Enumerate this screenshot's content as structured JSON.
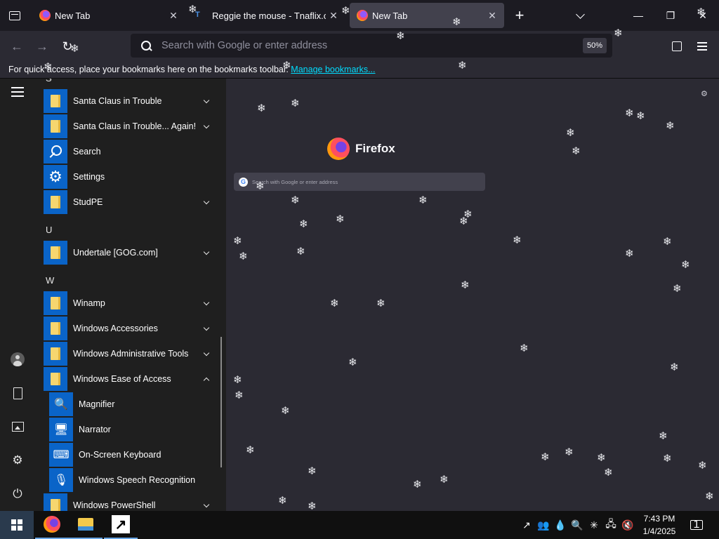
{
  "browser": {
    "tabs": [
      {
        "title": "New Tab",
        "close": "✕"
      },
      {
        "title": "Reggie the mouse - Tnaflix.com",
        "close": "✕"
      },
      {
        "title": "New Tab",
        "close": "✕"
      }
    ],
    "new_tab": "+",
    "window_controls": {
      "minimize": "—",
      "restore": "❐",
      "close": "✕"
    },
    "nav": {
      "back": "←",
      "forward": "→",
      "reload": "↻"
    },
    "urlbar_placeholder": "Search with Google or enter address",
    "zoom": "50%",
    "bookmarks_text": "For quick access, place your bookmarks here on the bookmarks toolbar.",
    "bookmarks_link": "Manage bookmarks..."
  },
  "newtab": {
    "brand": "Firefox",
    "search_placeholder": "Search with Google or enter address",
    "google_glyph": "G",
    "settings_glyph": "⚙"
  },
  "start_menu": {
    "rail_icons": [
      "hamburger-icon",
      "user-icon",
      "documents-icon",
      "pictures-icon",
      "settings-icon",
      "power-icon"
    ],
    "rail_glyphs": {
      "settings": "⚙",
      "power": "⏻"
    },
    "letters": {
      "s": "S",
      "u": "U",
      "w": "W"
    },
    "apps": [
      {
        "label": "Santa Claus in Trouble"
      },
      {
        "label": "Santa Claus in Trouble... Again!"
      },
      {
        "label": "Search"
      },
      {
        "label": "Settings"
      },
      {
        "label": "StudPE"
      },
      {
        "label": "Undertale [GOG.com]"
      },
      {
        "label": "Winamp"
      },
      {
        "label": "Windows Accessories"
      },
      {
        "label": "Windows Administrative Tools"
      },
      {
        "label": "Windows Ease of Access"
      },
      {
        "label": "Windows PowerShell"
      }
    ],
    "ease_of_access_items": [
      {
        "label": "Magnifier",
        "glyph": "🔍"
      },
      {
        "label": "Narrator",
        "glyph": "🖥"
      },
      {
        "label": "On-Screen Keyboard",
        "glyph": "⌨"
      },
      {
        "label": "Windows Speech Recognition",
        "glyph": "🎙"
      }
    ],
    "settings_glyph": "⚙"
  },
  "taskbar": {
    "tray": {
      "shortcut": "↗",
      "people": "👥",
      "drop": "💧",
      "search": "🔍",
      "network": "🖧",
      "volume": "🔇",
      "star": "✳"
    },
    "arrow_glyph": "↗",
    "time": "7:43 PM",
    "date": "1/4/2025",
    "notification_count": "1"
  },
  "decor": {
    "flake_glyph": "❄"
  }
}
